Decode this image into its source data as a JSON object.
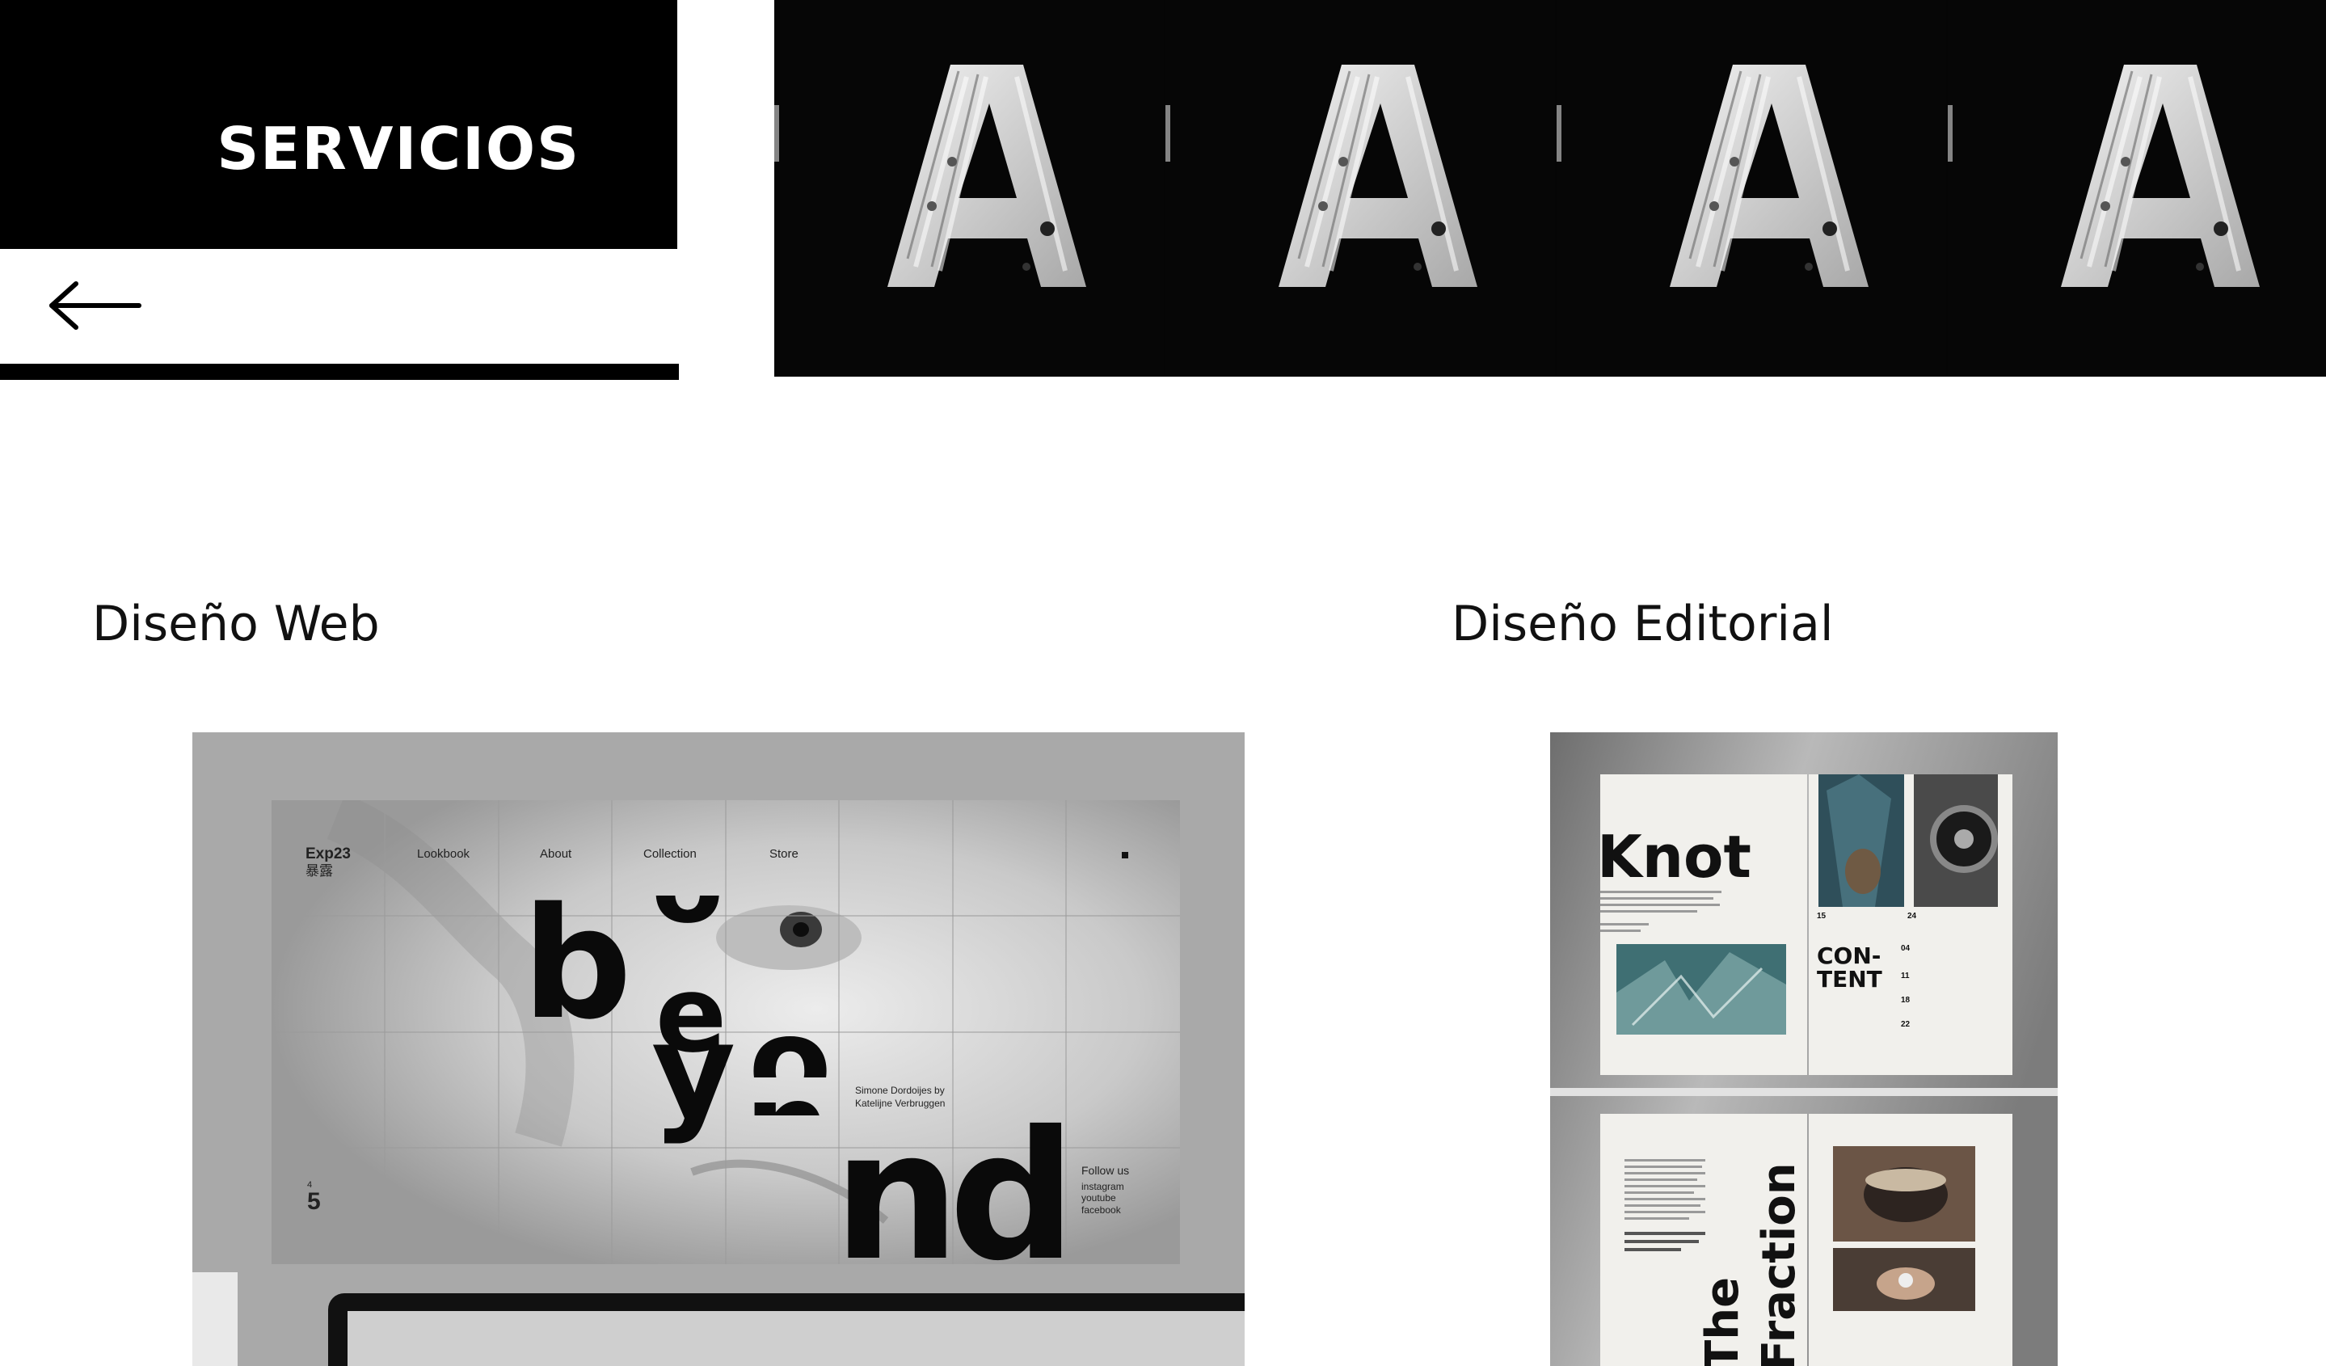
{
  "header": {
    "title": "SERVICIOS",
    "back_icon": "arrow-left-icon"
  },
  "banner": {
    "letter": "A",
    "repeat_count": 4
  },
  "sections": {
    "web": {
      "heading": "Diseño Web",
      "mockup": {
        "logo": "Exp23",
        "logo_sub": "暴露",
        "nav": [
          "Lookbook",
          "About",
          "Collection",
          "Store"
        ],
        "letters": [
          "b",
          "e",
          "y",
          "o",
          "n",
          "d"
        ],
        "credit": "Simone Dordoijes by Katelijne Verbruggen",
        "follow_title": "Follow us",
        "follow_links": [
          "instagram",
          "youtube",
          "facebook"
        ],
        "page_small": "4",
        "page_big": "5"
      }
    },
    "editorial": {
      "heading": "Diseño Editorial",
      "mockup": {
        "title_top": "Knot",
        "contents": "CON-\nTENT",
        "toc_numbers": [
          "15",
          "24",
          "04",
          "11",
          "18",
          "22"
        ],
        "title_bottom_1": "The",
        "title_bottom_2": "Fraction"
      }
    }
  },
  "colors": {
    "background": "#ffffff",
    "header_block": "#000000",
    "text": "#111111",
    "header_text": "#ffffff"
  }
}
